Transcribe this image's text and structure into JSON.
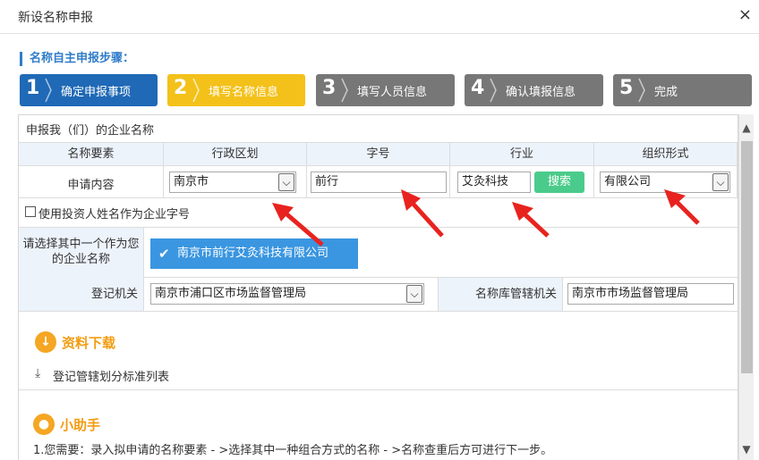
{
  "dialog": {
    "title": "新设名称申报",
    "close_glyph": "×"
  },
  "steps_title": "名称自主申报步骤：",
  "steps": [
    {
      "num": "1",
      "label": "确定申报事项",
      "color": "#2069b6"
    },
    {
      "num": "2",
      "label": "填写名称信息",
      "color": "#f3c11a"
    },
    {
      "num": "3",
      "label": "填写人员信息",
      "color": "#777777"
    },
    {
      "num": "4",
      "label": "确认填报信息",
      "color": "#777777"
    },
    {
      "num": "5",
      "label": "完成",
      "color": "#777777"
    }
  ],
  "form": {
    "section_title": "申报我（们）的企业名称",
    "headers": [
      "名称要素",
      "行政区划",
      "字号",
      "行业",
      "组织形式"
    ],
    "row_label": "申请内容",
    "region_value": "南京市",
    "trade_name_value": "前行",
    "industry_value": "艾灸科技",
    "search_label": "搜索",
    "org_form_value": "有限公司",
    "checkbox_label": "使用投资人姓名作为企业字号",
    "choose_label": "请选择其中一个作为您的企业名称",
    "choose_option": "南京市前行艾灸科技有限公司",
    "reg_authority_label": "登记机关",
    "reg_authority_value": "南京市浦口区市场监督管理局",
    "name_db_label": "名称库管辖机关",
    "name_db_value": "南京市市场监督管理局"
  },
  "download": {
    "title": "资料下载",
    "link": "登记管辖划分标准列表"
  },
  "helper": {
    "title": "小助手",
    "text": "1.您需要：录入拟申请的名称要素 - >选择其中一种组合方式的名称 - >名称查重后方可进行下一步。"
  },
  "colors": {
    "accent_blue": "#2069b6",
    "accent_yellow": "#f3c11a",
    "search_green": "#4bcb8b",
    "choose_blue": "#3a96e0",
    "section_orange": "#f39c12",
    "annotation_red": "#e8231f"
  }
}
